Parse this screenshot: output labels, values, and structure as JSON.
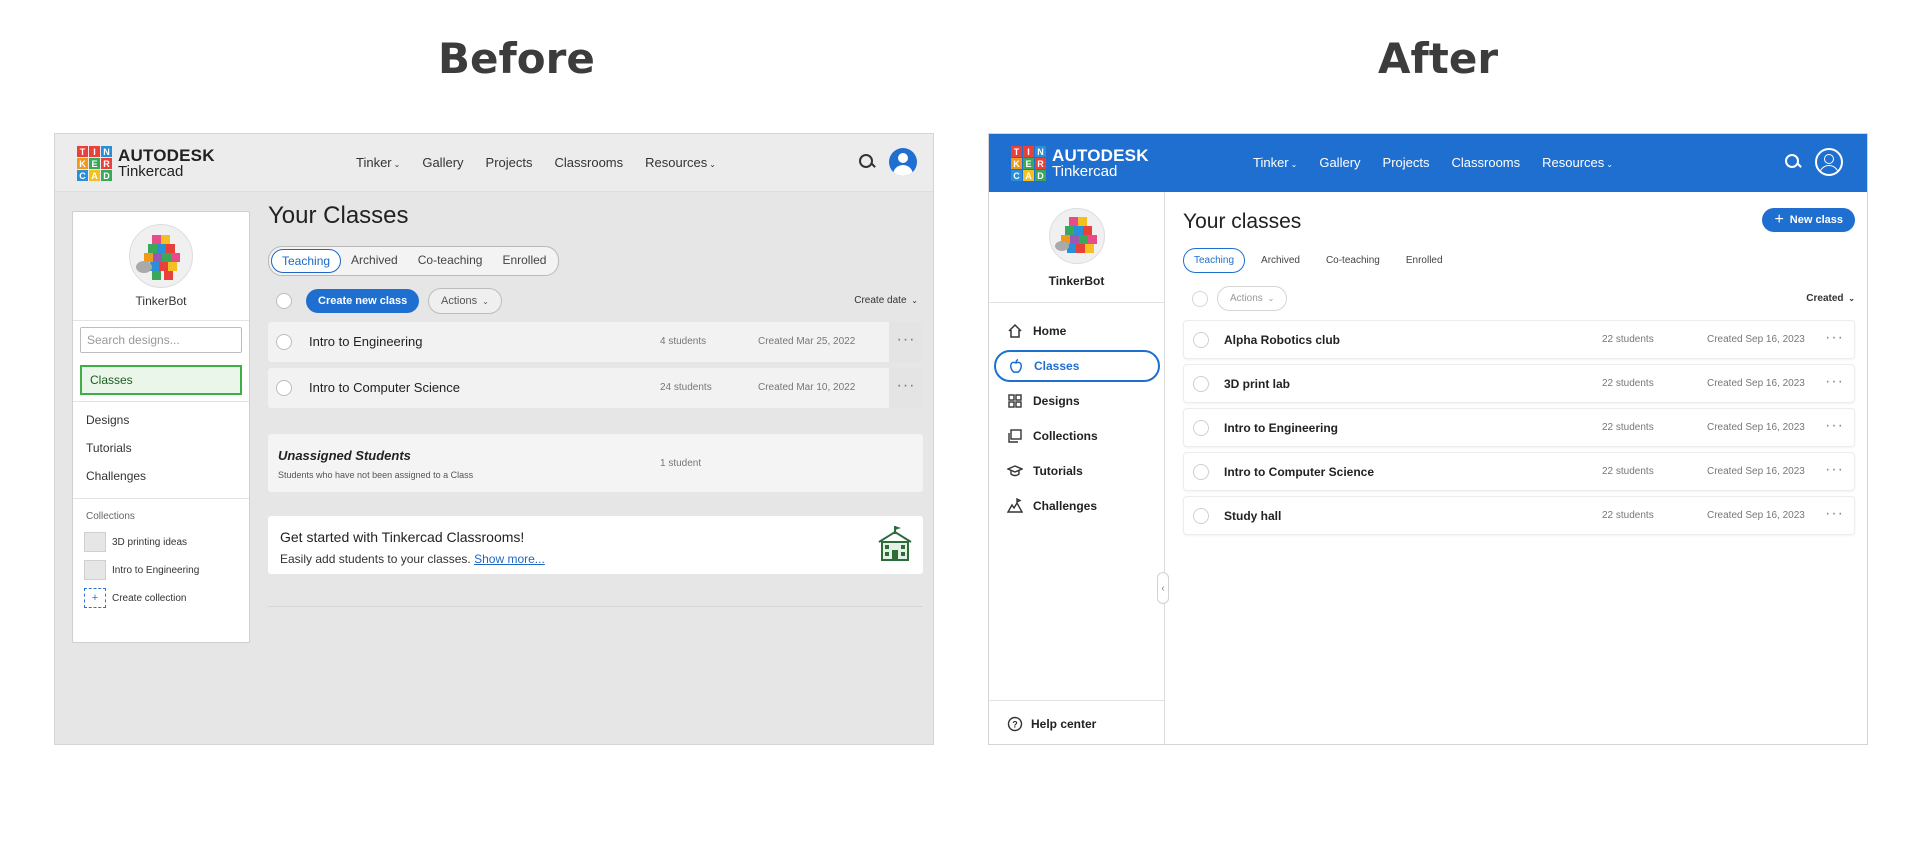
{
  "headings": {
    "before": "Before",
    "after": "After"
  },
  "colors": {
    "tinkercad_blue": "#1f6fd1",
    "before_bg": "#e6e6e6",
    "active_green": "#3fae49"
  },
  "logo": {
    "letters": [
      "T",
      "I",
      "N",
      "K",
      "E",
      "R",
      "C",
      "A",
      "D"
    ],
    "letter_colors": [
      "#e8403a",
      "#e8403a",
      "#2a8fd6",
      "#f09a1c",
      "#3aa85b",
      "#e8403a",
      "#2a8fd6",
      "#f4c020",
      "#3aa85b"
    ],
    "brand": "AUTODESK",
    "product": "Tinkercad"
  },
  "nav": [
    "Tinker",
    "Gallery",
    "Projects",
    "Classrooms",
    "Resources"
  ],
  "before": {
    "user": "TinkerBot",
    "search_placeholder": "Search designs...",
    "sidebar": [
      "Classes",
      "Designs",
      "Tutorials",
      "Challenges"
    ],
    "collections_label": "Collections",
    "collections": [
      "3D printing ideas",
      "Intro to Engineering"
    ],
    "create_collection": "Create collection",
    "page_title": "Your Classes",
    "tabs": [
      "Teaching",
      "Archived",
      "Co-teaching",
      "Enrolled"
    ],
    "create_button": "Create new class",
    "actions_button": "Actions",
    "sort_label": "Create date",
    "classes": [
      {
        "name": "Intro to Engineering",
        "students": "4 students",
        "created": "Created Mar 25, 2022"
      },
      {
        "name": "Intro to Computer Science",
        "students": "24 students",
        "created": "Created Mar 10, 2022"
      }
    ],
    "unassigned": {
      "title": "Unassigned Students",
      "subtitle": "Students who have not been assigned to a Class",
      "count": "1 student"
    },
    "banner": {
      "title": "Get started with Tinkercad Classrooms!",
      "text": "Easily add students to your classes.",
      "link": "Show more..."
    }
  },
  "after": {
    "user": "TinkerBot",
    "sidebar": [
      {
        "label": "Home",
        "icon": "home-icon"
      },
      {
        "label": "Classes",
        "icon": "apple-icon"
      },
      {
        "label": "Designs",
        "icon": "grid-icon"
      },
      {
        "label": "Collections",
        "icon": "collections-icon"
      },
      {
        "label": "Tutorials",
        "icon": "graduation-cap-icon"
      },
      {
        "label": "Challenges",
        "icon": "challenge-icon"
      }
    ],
    "help": "Help center",
    "page_title": "Your classes",
    "new_button": "New class",
    "tabs": [
      "Teaching",
      "Archived",
      "Co-teaching",
      "Enrolled"
    ],
    "actions_button": "Actions",
    "sort_label": "Created",
    "classes": [
      {
        "name": "Alpha Robotics club",
        "students": "22 students",
        "created": "Created Sep 16, 2023"
      },
      {
        "name": "3D print lab",
        "students": "22 students",
        "created": "Created Sep 16, 2023"
      },
      {
        "name": "Intro to Engineering",
        "students": "22 students",
        "created": "Created Sep 16, 2023"
      },
      {
        "name": "Intro to Computer Science",
        "students": "22 students",
        "created": "Created Sep 16, 2023"
      },
      {
        "name": "Study hall",
        "students": "22 students",
        "created": "Created Sep 16, 2023"
      }
    ]
  }
}
